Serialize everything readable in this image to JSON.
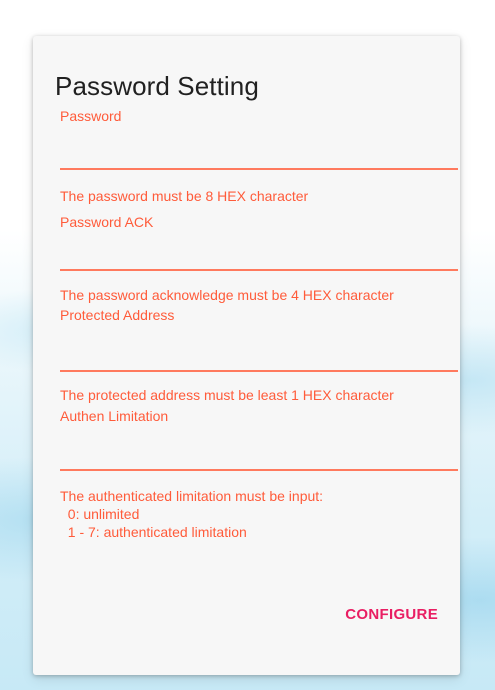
{
  "dialog": {
    "title": "Password Setting",
    "fields": [
      {
        "label": "Password",
        "value": "",
        "error": "The password must be 8 HEX character"
      },
      {
        "label": "Password ACK",
        "value": "",
        "error": "The password acknowledge must be 4 HEX character"
      },
      {
        "label": "Protected Address",
        "value": "",
        "error": "The protected address must be least 1 HEX character"
      },
      {
        "label": "Authen Limitation",
        "value": "",
        "error": "The authenticated limitation must be input:\n  0: unlimited\n  1 - 7: authenticated limitation"
      }
    ],
    "configure_label": "CONFIGURE"
  },
  "colors": {
    "accent": "#ff5b3a",
    "button": "#e91e63",
    "title": "#212121",
    "dialog_bg": "#f7f7f7"
  }
}
